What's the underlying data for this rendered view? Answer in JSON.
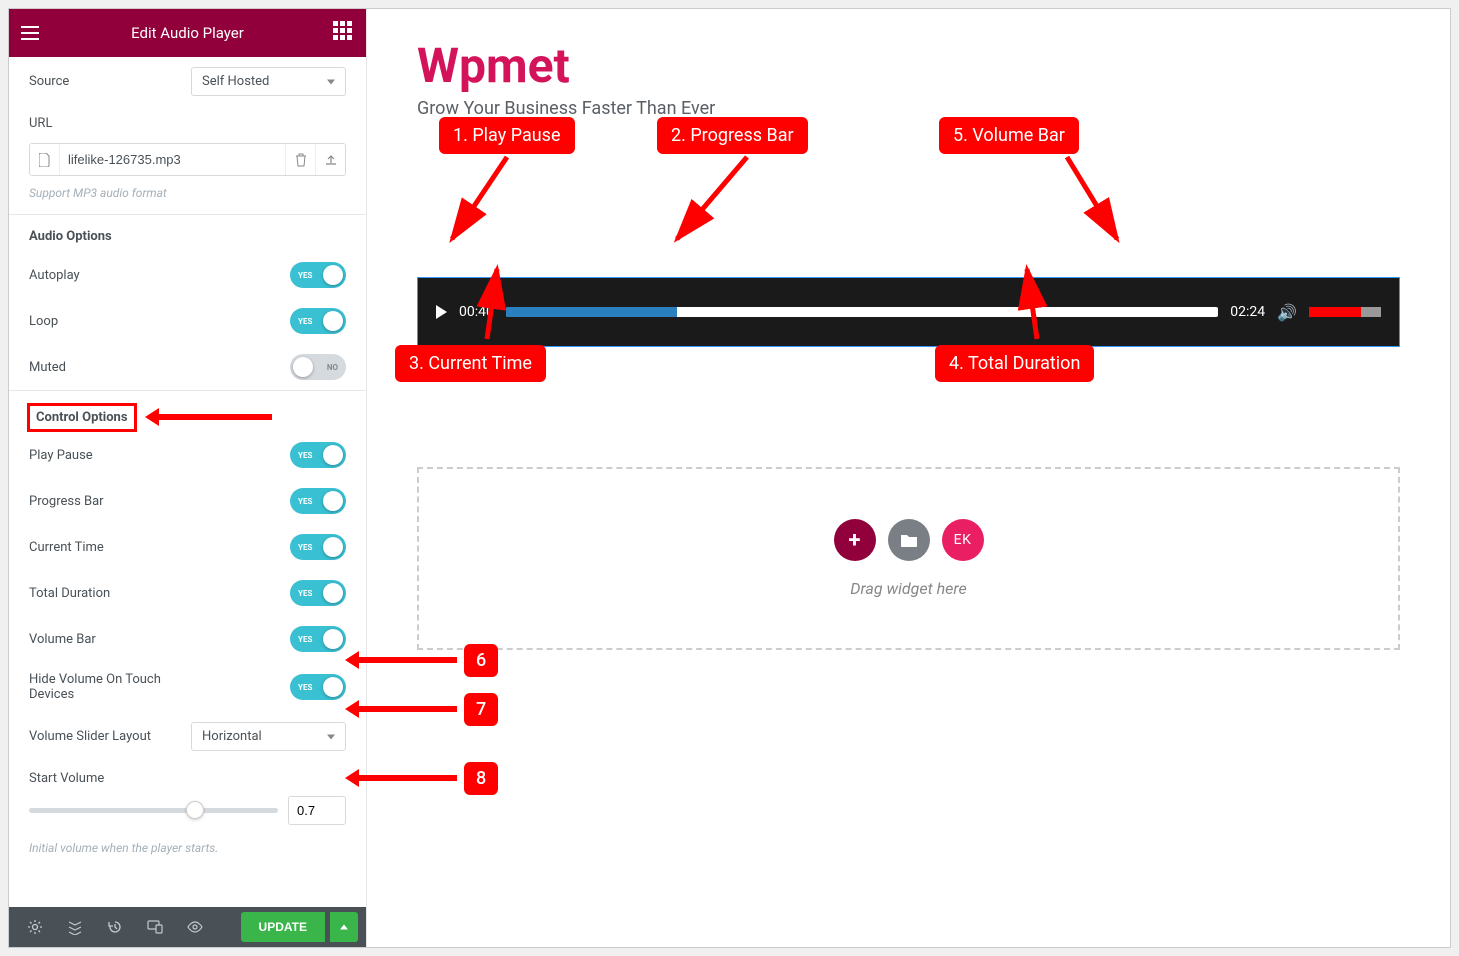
{
  "header": {
    "title": "Edit Audio Player"
  },
  "source": {
    "label": "Source",
    "value": "Self Hosted"
  },
  "url": {
    "label": "URL",
    "file": "lifelike-126735.mp3",
    "help": "Support MP3 audio format"
  },
  "audio_options": {
    "title": "Audio Options",
    "autoplay": {
      "label": "Autoplay",
      "state": "YES"
    },
    "loop": {
      "label": "Loop",
      "state": "YES"
    },
    "muted": {
      "label": "Muted",
      "state": "NO"
    }
  },
  "control_options": {
    "title": "Control Options",
    "play_pause": {
      "label": "Play Pause",
      "state": "YES"
    },
    "progress_bar": {
      "label": "Progress Bar",
      "state": "YES"
    },
    "current_time": {
      "label": "Current Time",
      "state": "YES"
    },
    "total_duration": {
      "label": "Total Duration",
      "state": "YES"
    },
    "volume_bar": {
      "label": "Volume Bar",
      "state": "YES"
    },
    "hide_volume": {
      "label": "Hide Volume On Touch Devices",
      "state": "YES"
    },
    "slider_layout": {
      "label": "Volume Slider Layout",
      "value": "Horizontal"
    },
    "start_volume": {
      "label": "Start Volume",
      "value": "0.7",
      "help": "Initial volume when the player starts."
    }
  },
  "footer": {
    "update": "UPDATE"
  },
  "preview": {
    "brand": "Wpmet",
    "tagline": "Grow Your Business Faster Than Ever",
    "player": {
      "current": "00:40",
      "total": "02:24"
    },
    "drop": "Drag widget here",
    "ek": "EK"
  },
  "annotations": {
    "c1": "1. Play Pause",
    "c2": "2. Progress Bar",
    "c3": "3. Current Time",
    "c4": "4. Total Duration",
    "c5": "5. Volume Bar",
    "n6": "6",
    "n7": "7",
    "n8": "8"
  }
}
